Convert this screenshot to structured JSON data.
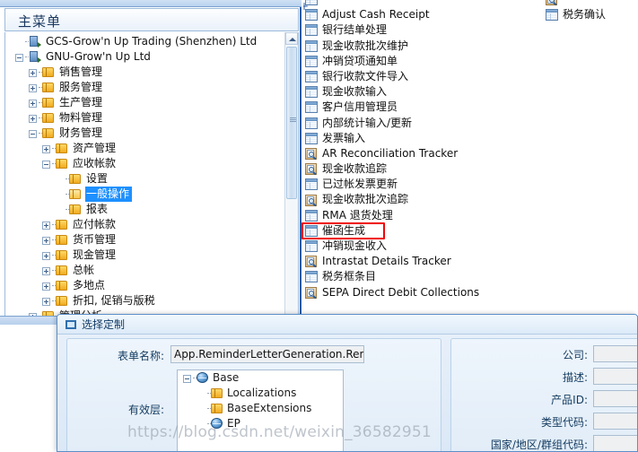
{
  "menu_panel": {
    "header_title": "主菜单",
    "tree": [
      {
        "label": "GCS-Grow'n Up Trading (Shenzhen) Ltd",
        "depth": 0,
        "icon": "building-icon",
        "expander": "none",
        "selected": false
      },
      {
        "label": "GNU-Grow'n Up Ltd",
        "depth": 0,
        "icon": "building-icon",
        "expander": "minus",
        "selected": false
      },
      {
        "label": "销售管理",
        "depth": 1,
        "icon": "folder-icon",
        "expander": "plus",
        "selected": false
      },
      {
        "label": "服务管理",
        "depth": 1,
        "icon": "folder-icon",
        "expander": "plus",
        "selected": false
      },
      {
        "label": "生产管理",
        "depth": 1,
        "icon": "folder-icon",
        "expander": "plus",
        "selected": false
      },
      {
        "label": "物料管理",
        "depth": 1,
        "icon": "folder-icon",
        "expander": "plus",
        "selected": false
      },
      {
        "label": "财务管理",
        "depth": 1,
        "icon": "folder-icon",
        "expander": "minus",
        "selected": false
      },
      {
        "label": "资产管理",
        "depth": 2,
        "icon": "folder-icon",
        "expander": "plus",
        "selected": false
      },
      {
        "label": "应收帐款",
        "depth": 2,
        "icon": "folder-icon",
        "expander": "minus",
        "selected": false
      },
      {
        "label": "设置",
        "depth": 3,
        "icon": "folder-icon",
        "expander": "none",
        "selected": false
      },
      {
        "label": "一般操作",
        "depth": 3,
        "icon": "folder-open-icon",
        "expander": "none",
        "selected": true
      },
      {
        "label": "报表",
        "depth": 3,
        "icon": "folder-icon",
        "expander": "none",
        "selected": false
      },
      {
        "label": "应付帐款",
        "depth": 2,
        "icon": "folder-icon",
        "expander": "plus",
        "selected": false
      },
      {
        "label": "货币管理",
        "depth": 2,
        "icon": "folder-icon",
        "expander": "plus",
        "selected": false
      },
      {
        "label": "现金管理",
        "depth": 2,
        "icon": "folder-icon",
        "expander": "plus",
        "selected": false
      },
      {
        "label": "总帐",
        "depth": 2,
        "icon": "folder-icon",
        "expander": "plus",
        "selected": false
      },
      {
        "label": "多地点",
        "depth": 2,
        "icon": "folder-icon",
        "expander": "plus",
        "selected": false
      },
      {
        "label": "折扣, 促销与版税",
        "depth": 2,
        "icon": "folder-icon",
        "expander": "plus",
        "selected": false
      },
      {
        "label": "管理分析",
        "depth": 1,
        "icon": "folder-icon",
        "expander": "plus",
        "selected": false
      },
      {
        "label": "",
        "depth": 1,
        "icon": "folder-icon",
        "expander": "plus",
        "selected": false
      },
      {
        "label": "",
        "depth": 1,
        "icon": "folder-icon",
        "expander": "minus",
        "selected": false
      }
    ]
  },
  "items_panel": {
    "column1": [
      {
        "label": "",
        "icon": "form-icon",
        "highlight": false
      },
      {
        "label": "Adjust Cash Receipt",
        "icon": "form-icon",
        "highlight": false
      },
      {
        "label": "银行结单处理",
        "icon": "form-icon",
        "highlight": false
      },
      {
        "label": "现金收款批次维护",
        "icon": "form-icon",
        "highlight": false
      },
      {
        "label": "冲销贷项通知单",
        "icon": "form-icon",
        "highlight": false
      },
      {
        "label": "银行收款文件导入",
        "icon": "form-icon",
        "highlight": false
      },
      {
        "label": "现金收款输入",
        "icon": "form-icon",
        "highlight": false
      },
      {
        "label": "客户信用管理员",
        "icon": "form-icon",
        "highlight": false
      },
      {
        "label": "内部统计输入/更新",
        "icon": "form-icon",
        "highlight": false
      },
      {
        "label": "发票输入",
        "icon": "form-icon",
        "highlight": false
      },
      {
        "label": "AR Reconciliation Tracker",
        "icon": "inquiry-icon",
        "highlight": false
      },
      {
        "label": "现金收款追踪",
        "icon": "inquiry-icon",
        "highlight": false
      },
      {
        "label": "已过帐发票更新",
        "icon": "form-icon",
        "highlight": false
      },
      {
        "label": "现金收款批次追踪",
        "icon": "inquiry-icon",
        "highlight": false
      },
      {
        "label": "RMA 退货处理",
        "icon": "form-icon",
        "highlight": false
      },
      {
        "label": "催函生成",
        "icon": "form-icon",
        "highlight": true
      },
      {
        "label": "冲销现金收入",
        "icon": "form-icon",
        "highlight": false
      },
      {
        "label": "Intrastat Details Tracker",
        "icon": "inquiry-icon",
        "highlight": false
      },
      {
        "label": "税务框条目",
        "icon": "form-icon",
        "highlight": false
      },
      {
        "label": "SEPA Direct Debit Collections",
        "icon": "inquiry-icon",
        "highlight": false
      }
    ],
    "column2": [
      {
        "label": "",
        "icon": "inquiry-icon",
        "highlight": false
      },
      {
        "label": "税务确认",
        "icon": "form-icon",
        "highlight": false
      }
    ]
  },
  "dialog": {
    "title": "选择定制",
    "form_name_label": "表单名称:",
    "form_name_value": "App.ReminderLetterGeneration.ReminderLetterGener",
    "form_name_highlight": "ReminderLetterGeneration.",
    "layers_label": "有效层:",
    "layers": [
      {
        "label": "Base",
        "depth": 0,
        "icon": "globe-icon",
        "expander": "minus"
      },
      {
        "label": "Localizations",
        "depth": 1,
        "icon": "folder-icon",
        "expander": "none"
      },
      {
        "label": "BaseExtensions",
        "depth": 1,
        "icon": "folder-icon",
        "expander": "none"
      },
      {
        "label": "EP",
        "depth": 1,
        "icon": "globe-icon",
        "expander": "none"
      }
    ],
    "fields": [
      {
        "label": "公司:",
        "value": ""
      },
      {
        "label": "描述:",
        "value": ""
      },
      {
        "label": "产品ID:",
        "value": ""
      },
      {
        "label": "类型代码:",
        "value": ""
      },
      {
        "label": "国家/地区/群组代码:",
        "value": ""
      }
    ]
  },
  "watermark": {
    "text": "https://blog.csdn.net/weixin_36582951"
  },
  "colors": {
    "accent": "#2d5ba3",
    "selection": "#1e90ff",
    "highlight": "#f00606",
    "panel_bg": "#e9f1fa"
  }
}
